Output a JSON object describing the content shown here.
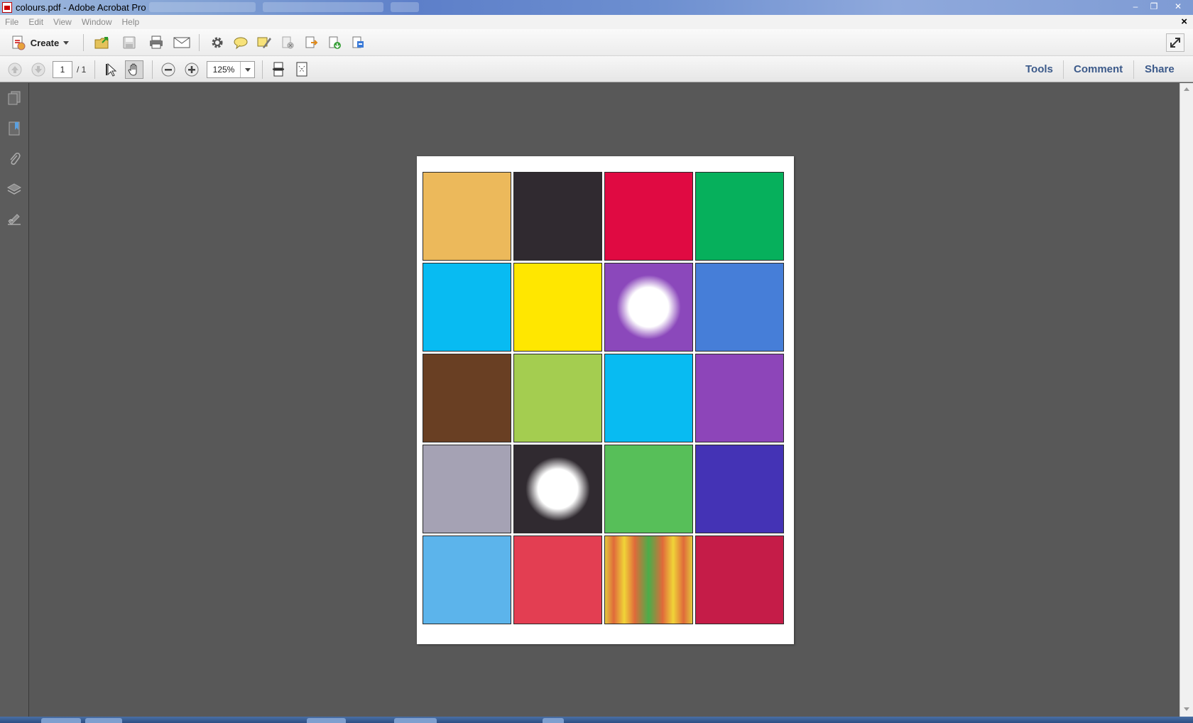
{
  "window": {
    "title": "colours.pdf - Adobe Acrobat Pro",
    "controls": {
      "minimize": "–",
      "restore": "❐",
      "close": "✕"
    }
  },
  "menubar": {
    "items": [
      "File",
      "Edit",
      "View",
      "Window",
      "Help"
    ],
    "close_doc": "×"
  },
  "toolbar": {
    "create_label": "Create",
    "icons": [
      "create-pdf-icon",
      "open-folder-icon",
      "save-icon",
      "print-icon",
      "email-icon",
      "settings-gear-icon",
      "comment-bubble-icon",
      "highlight-pen-icon",
      "delete-page-icon",
      "export-icon",
      "import-icon",
      "combine-icon",
      "fullscreen-icon"
    ]
  },
  "navbar": {
    "page_current": "1",
    "page_total": "/ 1",
    "zoom_value": "125%",
    "pane_links": [
      "Tools",
      "Comment",
      "Share"
    ]
  },
  "sidebar": {
    "icons": [
      "pages-icon",
      "bookmarks-icon",
      "attachments-icon",
      "layers-icon",
      "signatures-icon"
    ]
  },
  "document": {
    "swatches": [
      {
        "color": "#ecb95b",
        "effect": "none"
      },
      {
        "color": "#302a30",
        "effect": "none"
      },
      {
        "color": "#e00a42",
        "effect": "none"
      },
      {
        "color": "#06b05c",
        "effect": "none"
      },
      {
        "color": "#08bbf2",
        "effect": "none"
      },
      {
        "color": "#ffe700",
        "effect": "none"
      },
      {
        "color": "#8b48bb",
        "effect": "radial-glow"
      },
      {
        "color": "#467ed8",
        "effect": "none"
      },
      {
        "color": "#693f23",
        "effect": "none"
      },
      {
        "color": "#a4cd50",
        "effect": "none"
      },
      {
        "color": "#08bbf2",
        "effect": "none"
      },
      {
        "color": "#8d45b9",
        "effect": "none"
      },
      {
        "color": "#a5a2b4",
        "effect": "none"
      },
      {
        "color": "#302a30",
        "effect": "radial-glow"
      },
      {
        "color": "#57bf59",
        "effect": "none"
      },
      {
        "color": "#4433b5",
        "effect": "none"
      },
      {
        "color": "#5cb4eb",
        "effect": "none"
      },
      {
        "color": "#e33e52",
        "effect": "none"
      },
      {
        "color": "#e3c63c",
        "effect": "vertical-stripes"
      },
      {
        "color": "#c51c48",
        "effect": "none"
      }
    ]
  }
}
